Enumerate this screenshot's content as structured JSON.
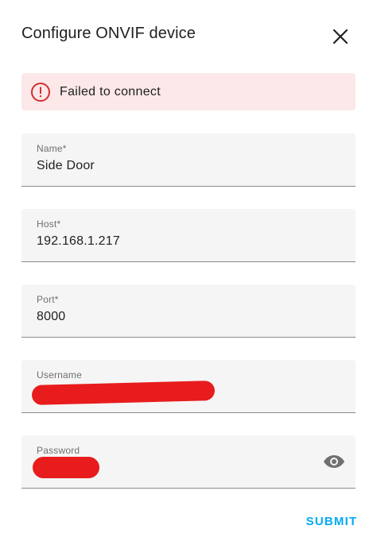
{
  "dialog": {
    "title": "Configure ONVIF device",
    "close_icon": "close-icon"
  },
  "alert": {
    "message": "Failed to connect",
    "icon": "error-icon",
    "color": "#d32f2f",
    "background": "#fce8e8"
  },
  "fields": {
    "name": {
      "label": "Name*",
      "value": "Side Door"
    },
    "host": {
      "label": "Host*",
      "value": "192.168.1.217"
    },
    "port": {
      "label": "Port*",
      "value": "8000"
    },
    "username": {
      "label": "Username",
      "value": ""
    },
    "password": {
      "label": "Password",
      "value": "",
      "toggle_icon": "eye-icon"
    }
  },
  "actions": {
    "submit_label": "SUBMIT",
    "accent_color": "#03a9f4"
  }
}
